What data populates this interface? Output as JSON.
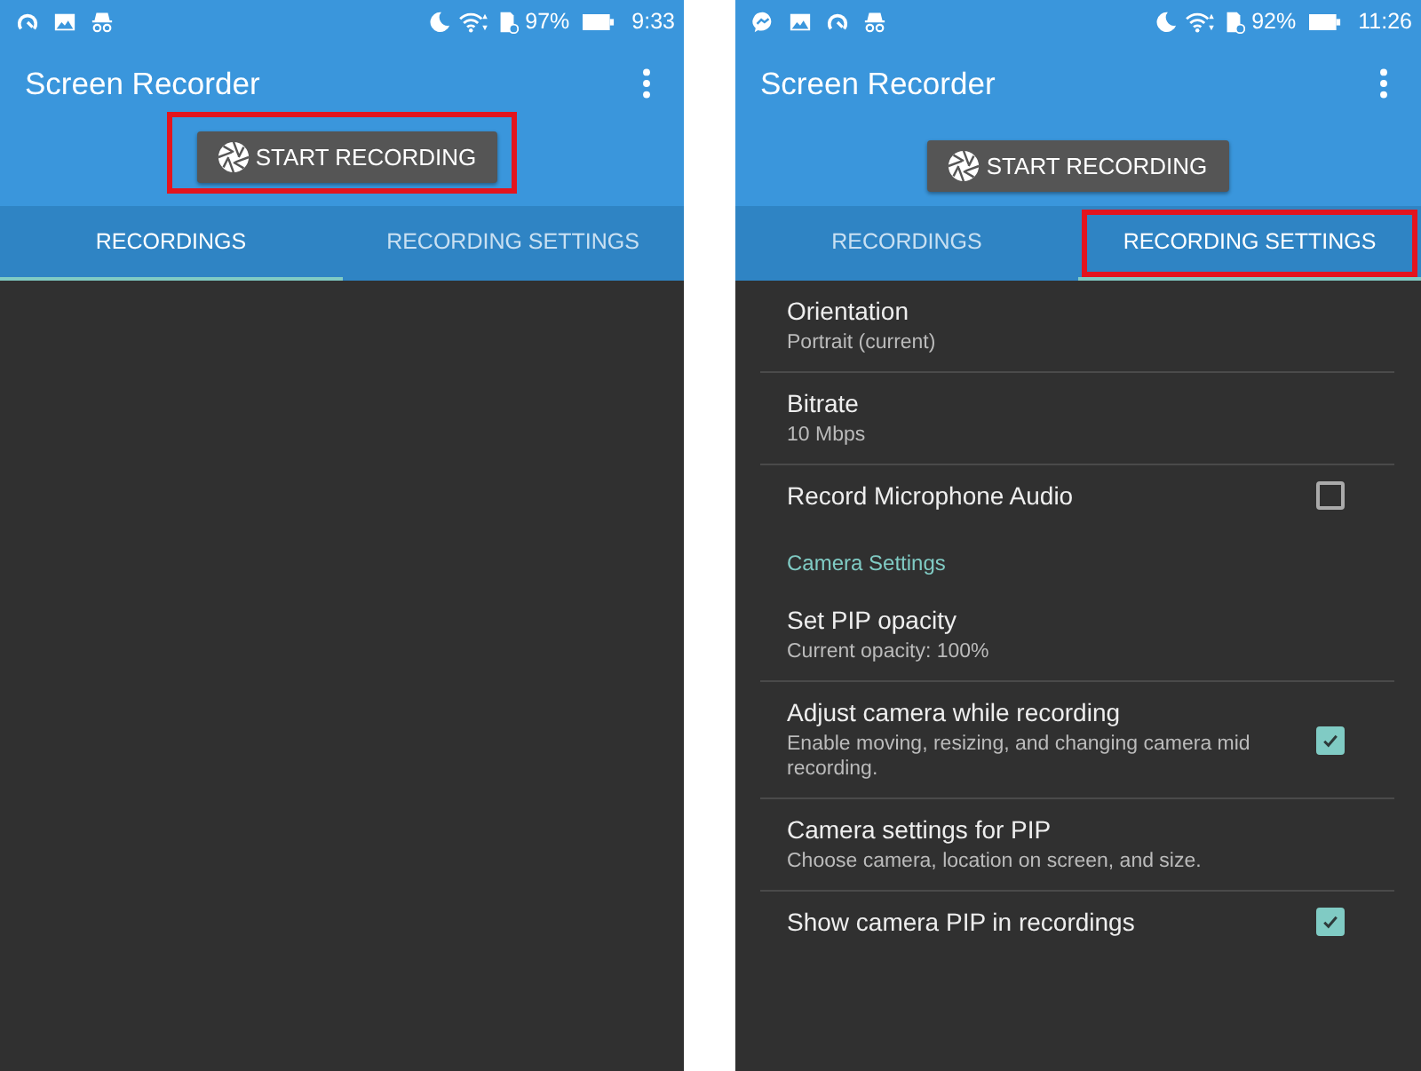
{
  "phones": [
    {
      "status_bar": {
        "notification_icons": [
          {
            "kind": "gauge"
          },
          {
            "kind": "image"
          },
          {
            "kind": "spy"
          }
        ],
        "battery": "97%",
        "time": "9:33"
      },
      "app_bar": {
        "title": "Screen Recorder"
      },
      "start_button": {
        "label": "START RECORDING",
        "highlighted": true
      },
      "tabs": [
        {
          "label": "RECORDINGS",
          "selected": true,
          "highlighted": false
        },
        {
          "label": "RECORDING SETTINGS",
          "selected": false,
          "highlighted": false
        }
      ]
    },
    {
      "status_bar": {
        "notification_icons": [
          {
            "kind": "messenger"
          },
          {
            "kind": "image"
          },
          {
            "kind": "gauge"
          },
          {
            "kind": "spy"
          }
        ],
        "battery": "92%",
        "time": "11:26"
      },
      "app_bar": {
        "title": "Screen Recorder"
      },
      "start_button": {
        "label": "START RECORDING",
        "highlighted": false
      },
      "tabs": [
        {
          "label": "RECORDINGS",
          "selected": false,
          "highlighted": false
        },
        {
          "label": "RECORDING SETTINGS",
          "selected": true,
          "highlighted": true
        }
      ],
      "settings": [
        {
          "kind": "item",
          "title": "Orientation",
          "summary": "Portrait (current)"
        },
        {
          "kind": "item",
          "title": "Bitrate",
          "summary": "10 Mbps"
        },
        {
          "kind": "checkbox",
          "title": "Record Microphone Audio",
          "checked": false
        },
        {
          "kind": "header",
          "title": "Camera Settings"
        },
        {
          "kind": "item",
          "title": "Set PIP opacity",
          "summary": "Current opacity: 100%"
        },
        {
          "kind": "checkbox",
          "title": "Adjust camera while recording",
          "summary": "Enable moving, resizing, and changing camera mid recording.",
          "checked": true
        },
        {
          "kind": "item",
          "title": "Camera settings for PIP",
          "summary": "Choose camera, location on screen, and size."
        },
        {
          "kind": "checkbox",
          "title": "Show camera PIP in recordings",
          "checked": true
        }
      ]
    }
  ]
}
